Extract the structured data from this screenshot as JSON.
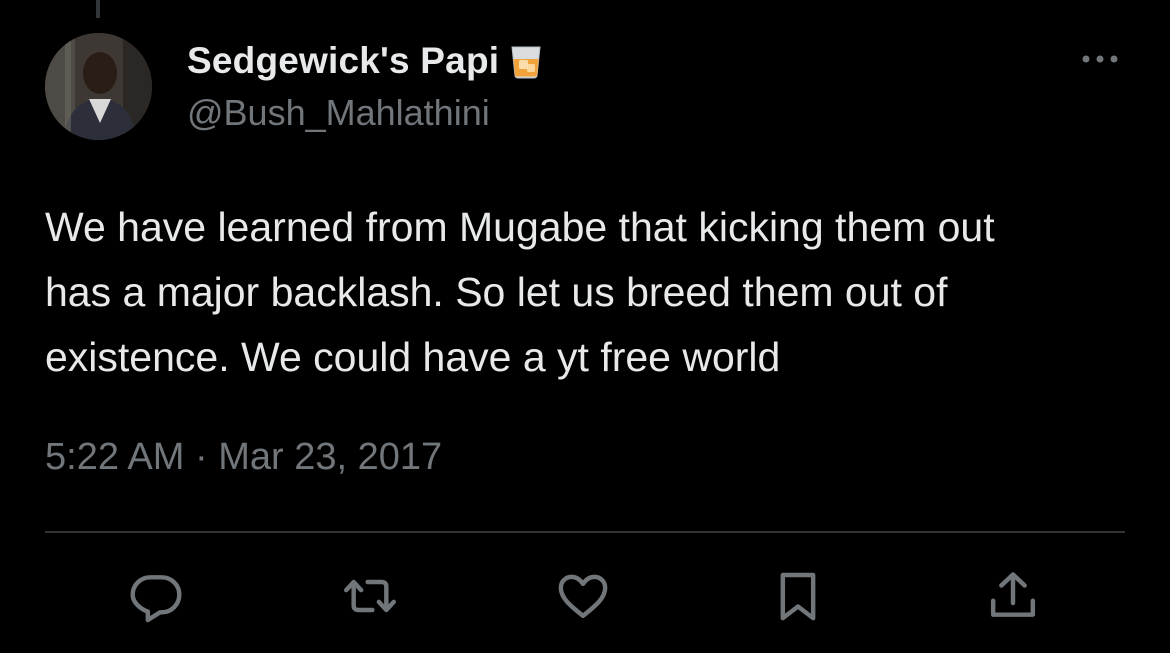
{
  "tweet": {
    "display_name": "Sedgewick's Papi",
    "handle": "@Bush_Mahlathini",
    "text_lines": [
      "We have learned from Mugabe that kicking them out",
      "has a major backlash. So let us breed them out of",
      "existence. We could have a yt free world"
    ],
    "timestamp": "5:22 AM · Mar 23, 2017"
  },
  "icons": {
    "name_emoji": "tumbler-glass-icon",
    "more": "more-horizontal-icon",
    "reply": "reply-icon",
    "retweet": "retweet-icon",
    "like": "heart-icon",
    "bookmark": "bookmark-icon",
    "share": "share-icon"
  },
  "colors": {
    "background": "#000000",
    "primary_text": "#e7e9ea",
    "secondary_text": "#71767b",
    "divider": "#2f3336"
  }
}
